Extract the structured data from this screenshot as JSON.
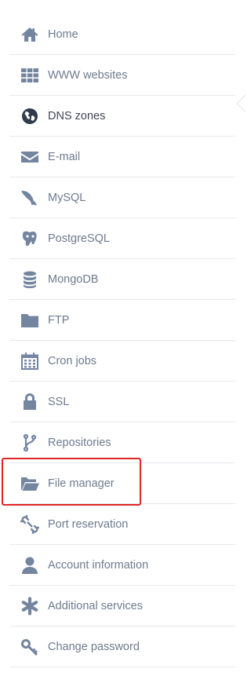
{
  "colors": {
    "icon": "#7485a0",
    "label": "#6e7b8e",
    "active_label": "#3e4653",
    "divider": "#e6e9ee",
    "highlight": "#e02525"
  },
  "sidebar": {
    "items": [
      {
        "label": "Home",
        "icon": "home-icon"
      },
      {
        "label": "WWW websites",
        "icon": "grid-icon"
      },
      {
        "label": "DNS zones",
        "icon": "globe-icon",
        "active": true
      },
      {
        "label": "E-mail",
        "icon": "envelope-icon"
      },
      {
        "label": "MySQL",
        "icon": "dolphin-icon"
      },
      {
        "label": "PostgreSQL",
        "icon": "elephant-icon"
      },
      {
        "label": "MongoDB",
        "icon": "database-icon"
      },
      {
        "label": "FTP",
        "icon": "folder-icon"
      },
      {
        "label": "Cron jobs",
        "icon": "calendar-icon"
      },
      {
        "label": "SSL",
        "icon": "lock-icon"
      },
      {
        "label": "Repositories",
        "icon": "branch-icon"
      },
      {
        "label": "File manager",
        "icon": "folder-open-icon",
        "highlighted": true
      },
      {
        "label": "Port reservation",
        "icon": "unlink-icon"
      },
      {
        "label": "Account information",
        "icon": "user-icon"
      },
      {
        "label": "Additional services",
        "icon": "asterisk-icon"
      },
      {
        "label": "Change password",
        "icon": "key-icon"
      }
    ]
  }
}
